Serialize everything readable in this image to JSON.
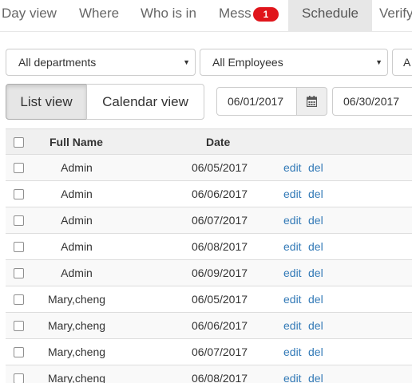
{
  "nav": {
    "tabs": [
      {
        "label": "Day view",
        "active": false
      },
      {
        "label": "Where",
        "active": false
      },
      {
        "label": "Who is in",
        "active": false
      },
      {
        "label": "Mess",
        "active": false,
        "badge": "1"
      },
      {
        "label": "Schedule",
        "active": true
      },
      {
        "label": "Verify",
        "active": false
      }
    ]
  },
  "filters": {
    "department": "All departments",
    "employees": "All Employees",
    "third": "A"
  },
  "view_toggle": {
    "list": "List view",
    "calendar": "Calendar view",
    "active": "list"
  },
  "date_range": {
    "from": "06/01/2017",
    "to": "06/30/2017"
  },
  "table": {
    "headers": {
      "name": "Full Name",
      "date": "Date"
    },
    "edit_label": "edit",
    "del_label": "del",
    "rows": [
      {
        "name": "Admin",
        "date": "06/05/2017"
      },
      {
        "name": "Admin",
        "date": "06/06/2017"
      },
      {
        "name": "Admin",
        "date": "06/07/2017"
      },
      {
        "name": "Admin",
        "date": "06/08/2017"
      },
      {
        "name": "Admin",
        "date": "06/09/2017"
      },
      {
        "name": "Mary,cheng",
        "date": "06/05/2017"
      },
      {
        "name": "Mary,cheng",
        "date": "06/06/2017"
      },
      {
        "name": "Mary,cheng",
        "date": "06/07/2017"
      },
      {
        "name": "Mary,cheng",
        "date": "06/08/2017"
      }
    ]
  },
  "colors": {
    "link": "#337ab7",
    "badge": "#e0151b",
    "active_tab": "#e7e7e7"
  }
}
